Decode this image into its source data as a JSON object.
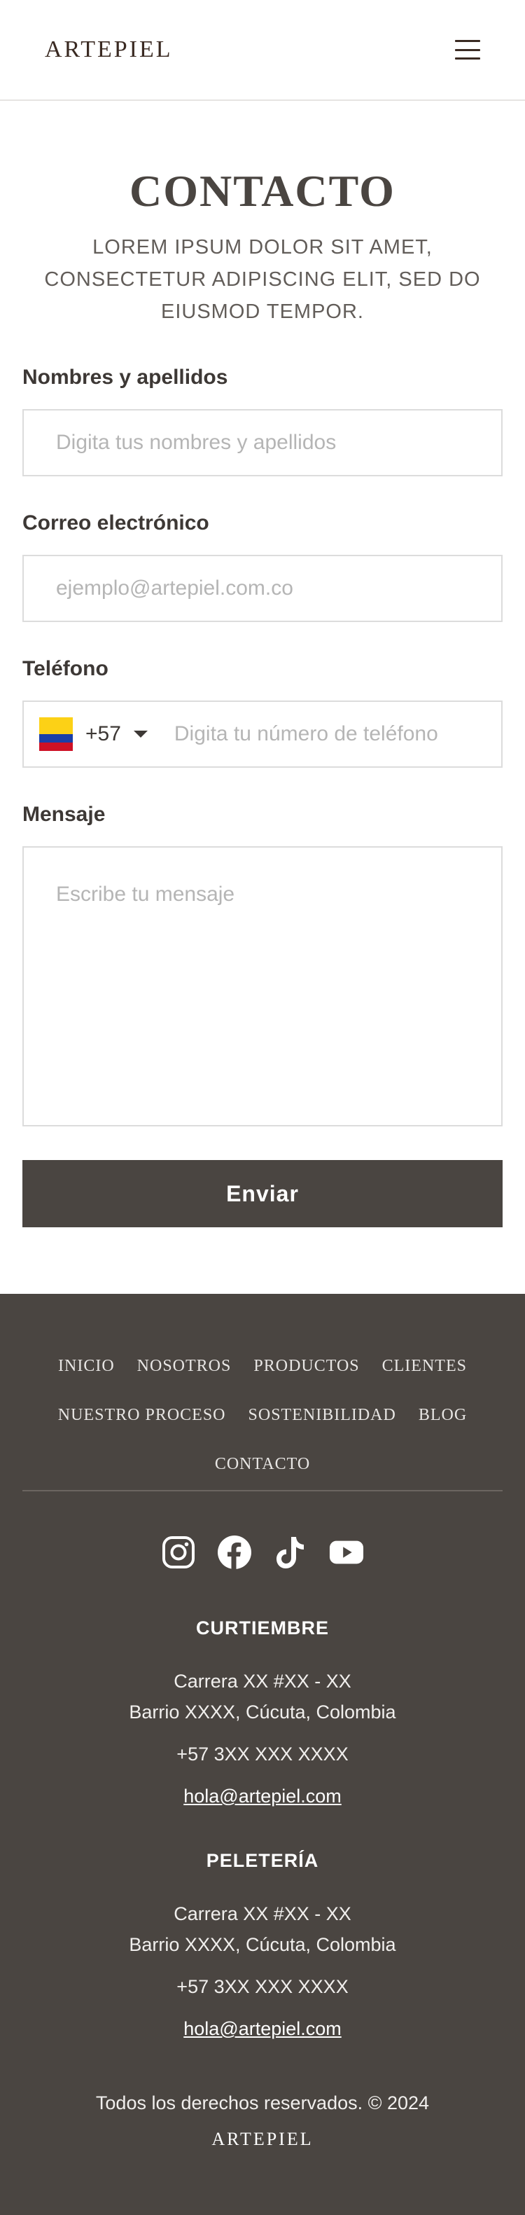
{
  "header": {
    "logo": "ARTEPIEL",
    "menu_icon": "hamburger-menu-icon"
  },
  "hero": {
    "title": "CONTACTO",
    "subtitle": "LOREM IPSUM DOLOR SIT AMET, CONSECTETUR ADIPISCING ELIT, SED DO EIUSMOD TEMPOR."
  },
  "form": {
    "name_label": "Nombres y apellidos",
    "name_placeholder": "Digita tus nombres y apellidos",
    "email_label": "Correo electrónico",
    "email_placeholder": "ejemplo@artepiel.com.co",
    "phone_label": "Teléfono",
    "phone_country_code": "+57",
    "phone_flag_icon": "colombia-flag-icon",
    "phone_placeholder": "Digita tu número de teléfono",
    "message_label": "Mensaje",
    "message_placeholder": "Escribe tu mensaje",
    "submit_label": "Enviar"
  },
  "footer": {
    "nav": [
      "INICIO",
      "NOSOTROS",
      "PRODUCTOS",
      "CLIENTES",
      "NUESTRO PROCESO",
      "SOSTENIBILIDAD",
      "BLOG",
      "CONTACTO"
    ],
    "social_icons": [
      "instagram-icon",
      "facebook-icon",
      "tiktok-icon",
      "youtube-icon"
    ],
    "curtiembre": {
      "title": "CURTIEMBRE",
      "address_line1": "Carrera XX #XX - XX",
      "address_line2": "Barrio XXXX, Cúcuta, Colombia",
      "phone": "+57 3XX XXX XXXX",
      "email": "hola@artepiel.com"
    },
    "peleteria": {
      "title": "PELETERÍA",
      "address_line1": "Carrera XX #XX - XX",
      "address_line2": "Barrio XXXX, Cúcuta, Colombia",
      "phone": "+57 3XX XXX XXXX",
      "email": "hola@artepiel.com"
    },
    "copyright": "Todos los derechos reservados. © 2024",
    "logo": "ARTEPIEL"
  },
  "colors": {
    "dark": "#4a4541",
    "logo_brown": "#3a2a22",
    "border": "#dcdcdc",
    "placeholder": "#b5b5b5"
  }
}
